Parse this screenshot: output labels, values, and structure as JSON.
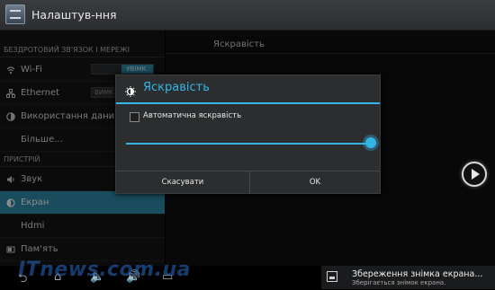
{
  "app": {
    "title": "Налаштув-ння",
    "icon": "settings-app-icon"
  },
  "sidebar": {
    "sections": [
      {
        "label": "БЕЗДРОТОВИЙ ЗВ'ЯЗОК І МЕРЕЖІ"
      },
      {
        "label": "ПРИСТРІЙ"
      }
    ],
    "items": [
      {
        "label": "Wi-Fi",
        "icon": "wifi-icon",
        "toggle": "УВІМК."
      },
      {
        "label": "Ethernet",
        "icon": "ethernet-icon",
        "toggle_off": "ВИМК."
      },
      {
        "label": "Використання даних",
        "icon": "data-usage-icon"
      },
      {
        "label": "Більше..."
      },
      {
        "label": "Звук",
        "icon": "sound-icon"
      },
      {
        "label": "Екран",
        "icon": "display-icon",
        "selected": true
      },
      {
        "label": "Hdmi"
      },
      {
        "label": "Пам'ять",
        "icon": "storage-icon"
      }
    ]
  },
  "right_pane": {
    "header": "Яскравість"
  },
  "dialog": {
    "title": "Яскравість",
    "icon": "brightness-icon",
    "auto_label": "Автоматична яскравість",
    "auto_checked": false,
    "brightness_level": 1.0,
    "cancel_label": "Скасувати",
    "ok_label": "OK"
  },
  "notification": {
    "title": "Збереження знімка екрана...",
    "subtitle": "Зберігається знімок екрана."
  },
  "watermark": "ITnews.com.ua",
  "colors": {
    "accent": "#33b5e5",
    "selected_bg": "#2f8aa8"
  }
}
